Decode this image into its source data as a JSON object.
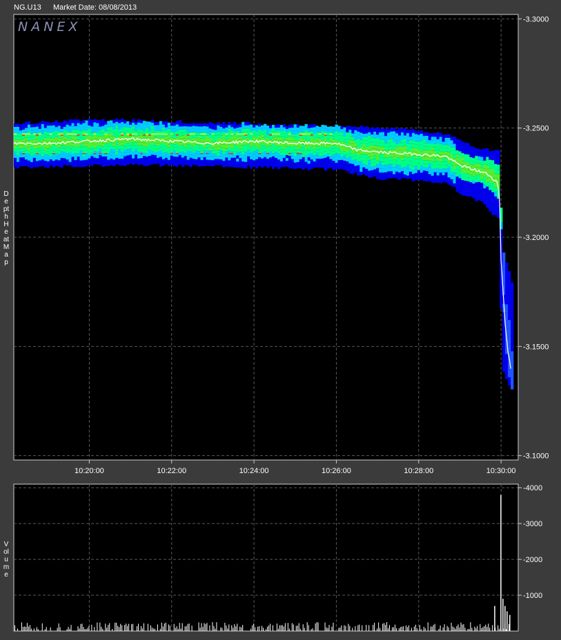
{
  "header": {
    "symbol": "NG.U13",
    "market_date": "Market Date: 08/08/2013"
  },
  "brand": {
    "logo_text": "NANEX"
  },
  "panels": {
    "depth_label": "Depth Heat Map",
    "volume_label": "Volume"
  },
  "colors": {
    "background": "#000000",
    "frame": "#3a3b3a",
    "grid": "#5a5a5a",
    "price_line": "#ffffff",
    "heat_low": "#0000ee",
    "heat_mid_low": "#00ccff",
    "heat_mid": "#00ff88",
    "heat_mid_high": "#ffff00",
    "heat_high": "#ff2200"
  },
  "chart_data": [
    {
      "type": "heatmap",
      "title": "",
      "xlabel": "",
      "ylabel": "Depth Heat Map",
      "x_ticks": [
        "10:20:00",
        "10:22:00",
        "10:24:00",
        "10:26:00",
        "10:28:00",
        "10:30:00"
      ],
      "y_ticks": [
        "-3.3000",
        "-3.2500",
        "-3.2000",
        "-3.1500",
        "-3.1000"
      ],
      "xlim": [
        "10:18:10",
        "10:30:25"
      ],
      "ylim": [
        3.098,
        3.302
      ],
      "grid": true,
      "price_path": [
        {
          "t": "10:18:10",
          "price": 3.243
        },
        {
          "t": "10:19:00",
          "price": 3.243
        },
        {
          "t": "10:20:00",
          "price": 3.244
        },
        {
          "t": "10:21:00",
          "price": 3.245
        },
        {
          "t": "10:22:00",
          "price": 3.244
        },
        {
          "t": "10:23:00",
          "price": 3.243
        },
        {
          "t": "10:24:00",
          "price": 3.244
        },
        {
          "t": "10:25:00",
          "price": 3.243
        },
        {
          "t": "10:26:00",
          "price": 3.243
        },
        {
          "t": "10:26:30",
          "price": 3.24
        },
        {
          "t": "10:27:00",
          "price": 3.239
        },
        {
          "t": "10:28:00",
          "price": 3.238
        },
        {
          "t": "10:28:40",
          "price": 3.237
        },
        {
          "t": "10:29:00",
          "price": 3.233
        },
        {
          "t": "10:29:20",
          "price": 3.231
        },
        {
          "t": "10:29:40",
          "price": 3.229
        },
        {
          "t": "10:29:55",
          "price": 3.225
        },
        {
          "t": "10:29:58",
          "price": 3.216
        },
        {
          "t": "10:30:00",
          "price": 3.19
        },
        {
          "t": "10:30:03",
          "price": 3.175
        },
        {
          "t": "10:30:06",
          "price": 3.16
        },
        {
          "t": "10:30:10",
          "price": 3.148
        },
        {
          "t": "10:30:14",
          "price": 3.14
        }
      ],
      "depth_band": [
        {
          "t": "10:18:10",
          "high": 3.252,
          "low": 3.232
        },
        {
          "t": "10:20:00",
          "high": 3.254,
          "low": 3.233
        },
        {
          "t": "10:22:00",
          "high": 3.253,
          "low": 3.233
        },
        {
          "t": "10:24:00",
          "high": 3.252,
          "low": 3.232
        },
        {
          "t": "10:26:00",
          "high": 3.251,
          "low": 3.231
        },
        {
          "t": "10:27:00",
          "high": 3.25,
          "low": 3.227
        },
        {
          "t": "10:28:00",
          "high": 3.249,
          "low": 3.226
        },
        {
          "t": "10:28:40",
          "high": 3.247,
          "low": 3.225
        },
        {
          "t": "10:29:00",
          "high": 3.244,
          "low": 3.22
        },
        {
          "t": "10:29:30",
          "high": 3.24,
          "low": 3.216
        },
        {
          "t": "10:29:55",
          "high": 3.24,
          "low": 3.208
        },
        {
          "t": "10:30:00",
          "high": 3.195,
          "low": 3.14
        },
        {
          "t": "10:30:14",
          "high": 3.18,
          "low": 3.13
        }
      ]
    },
    {
      "type": "bar",
      "title": "",
      "xlabel": "",
      "ylabel": "Volume",
      "y_ticks": [
        "-4000",
        "-3000",
        "-2000",
        "-1000"
      ],
      "ylim": [
        0,
        4100
      ],
      "grid": true,
      "notable_bars": [
        {
          "t": "10:29:50",
          "volume": 700
        },
        {
          "t": "10:29:59",
          "volume": 3800
        },
        {
          "t": "10:30:02",
          "volume": 900
        },
        {
          "t": "10:30:05",
          "volume": 700
        },
        {
          "t": "10:30:08",
          "volume": 550
        },
        {
          "t": "10:30:12",
          "volume": 450
        }
      ],
      "baseline_volume_range": [
        50,
        250
      ]
    }
  ]
}
